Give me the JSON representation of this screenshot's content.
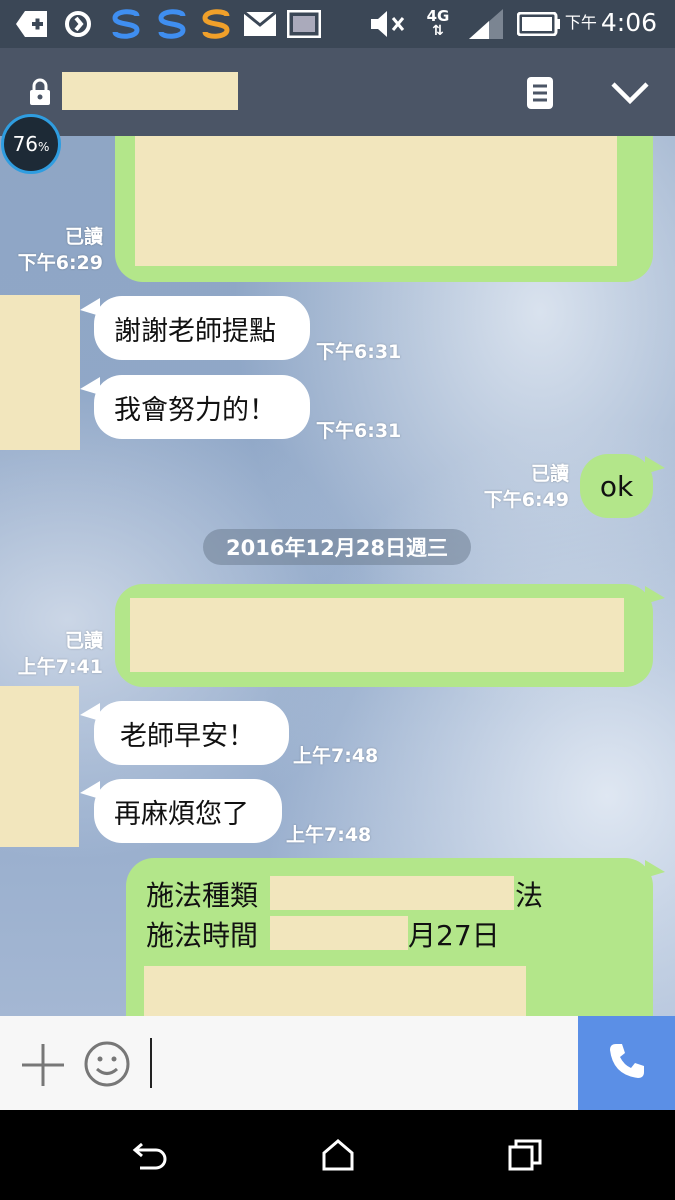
{
  "status_bar": {
    "network": "4G",
    "time_period": "下午",
    "time": "4:06"
  },
  "header": {
    "battery_overlay": "76",
    "battery_unit": "%"
  },
  "messages": {
    "out1": {
      "read": "已讀",
      "time": "下午6:29"
    },
    "in1": {
      "text": "謝謝老師提點",
      "time": "下午6:31"
    },
    "in2": {
      "text": "我會努力的！",
      "time": "下午6:31"
    },
    "out2": {
      "text": "ok",
      "read": "已讀",
      "time": "下午6:49"
    },
    "date_separator": "2016年12月28日週三",
    "out3": {
      "read": "已讀",
      "time": "上午7:41"
    },
    "in3": {
      "text": "老師早安！",
      "time": "上午7:48"
    },
    "in4": {
      "text": "再麻煩您了",
      "time": "上午7:48"
    },
    "out4": {
      "line1_label": "施法種類",
      "line1_suffix": "法",
      "line2_label": "施法時間",
      "line2_suffix": "月27日"
    }
  },
  "icons": {
    "lock": "lock-icon",
    "menu": "menu-icon",
    "collapse": "chevron-down-icon",
    "add": "plus-icon",
    "emoji": "emoji-icon",
    "call": "phone-icon",
    "back": "back-icon",
    "home": "home-icon",
    "recents": "recents-icon"
  },
  "colors": {
    "outgoing_bubble": "#b3e68a",
    "incoming_bubble": "#ffffff",
    "call_button": "#5b8fe6",
    "header": "#4b5566"
  }
}
